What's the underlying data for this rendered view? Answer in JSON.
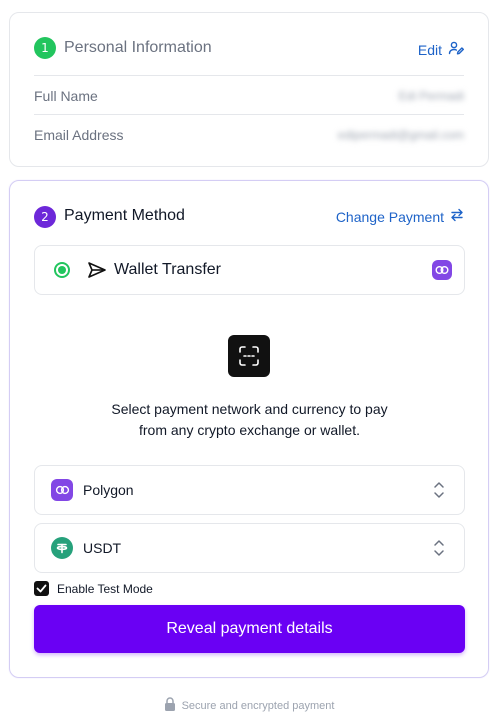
{
  "personal": {
    "step_number": "1",
    "title": "Personal Information",
    "edit_label": "Edit",
    "fields": [
      {
        "label": "Full Name",
        "value": "Edi Permadi"
      },
      {
        "label": "Email Address",
        "value": "edipermadi@gmail.com"
      }
    ]
  },
  "payment": {
    "step_number": "2",
    "title": "Payment Method",
    "change_label": "Change Payment",
    "method_label": "Wallet Transfer",
    "description_line1": "Select payment network and currency to pay",
    "description_line2": "from any crypto exchange or wallet.",
    "network": {
      "selected": "Polygon",
      "icon": "polygon-icon"
    },
    "currency": {
      "selected": "USDT",
      "icon": "tether-icon"
    },
    "test_mode_label": "Enable Test Mode",
    "test_mode_checked": true,
    "reveal_button_label": "Reveal payment details"
  },
  "footer": {
    "secure_text": "Secure and encrypted payment"
  },
  "colors": {
    "accent": "#6a00f4",
    "step_green": "#22c55e",
    "step_purple": "#6d28d9",
    "link_blue": "#1e63c8",
    "polygon": "#8247e5",
    "tether": "#26a17b"
  }
}
